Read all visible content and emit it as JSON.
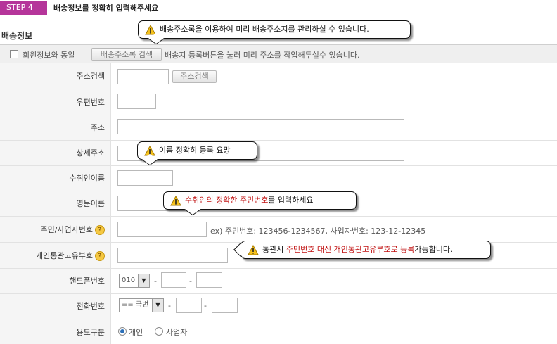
{
  "header": {
    "step": "STEP 4",
    "title": "배송정보를 정확히 입력해주세요"
  },
  "section": {
    "title": "배송정보"
  },
  "same_row": {
    "checkbox_label": "회원정보와 동일",
    "address_book_button": "배송주소록 검색",
    "note": "배송지 등록버튼을 눌러 미리 주소를 작업해두실수 있습니다."
  },
  "form": {
    "address_search_label": "주소검색",
    "address_search_button": "주소검색",
    "postal_label": "우편번호",
    "address_label": "주소",
    "detail_label": "상세주소",
    "recipient_label": "수취인이름",
    "english_name_label": "영문이름",
    "id_label": "주민/사업자번호",
    "id_example": "ex) 주민번호: 123456-1234567, 사업자번호: 123-12-12345",
    "customs_label": "개인통관고유부호",
    "help_icon_glyph": "?",
    "mobile_label": "핸드폰번호",
    "mobile_prefix": "010",
    "phone_label": "전화번호",
    "phone_prefix": "== 국번",
    "dash": "-",
    "usage_label": "용도구분",
    "usage_personal": "개인",
    "usage_business": "사업자"
  },
  "tooltips": {
    "address_book": "배송주소록을 이용하여 미리 배송주소지를 관리하실 수 있습니다.",
    "name": "이름 정확히 등록 요망",
    "id_red": "수취인의 정확한 주민번호",
    "id_rest": "를 입력하세요",
    "customs_a": "통관시 ",
    "customs_red": "주민번호 대신 개인통관고유부호로 등록",
    "customs_b": "가능합니다."
  },
  "colors": {
    "step_badge": "#b5359a",
    "warning_red": "#c01010",
    "label_bg": "#f5f5f5"
  },
  "icons": {
    "warning": "warning-icon",
    "help": "help-icon",
    "dropdown": "chevron-down-icon"
  }
}
